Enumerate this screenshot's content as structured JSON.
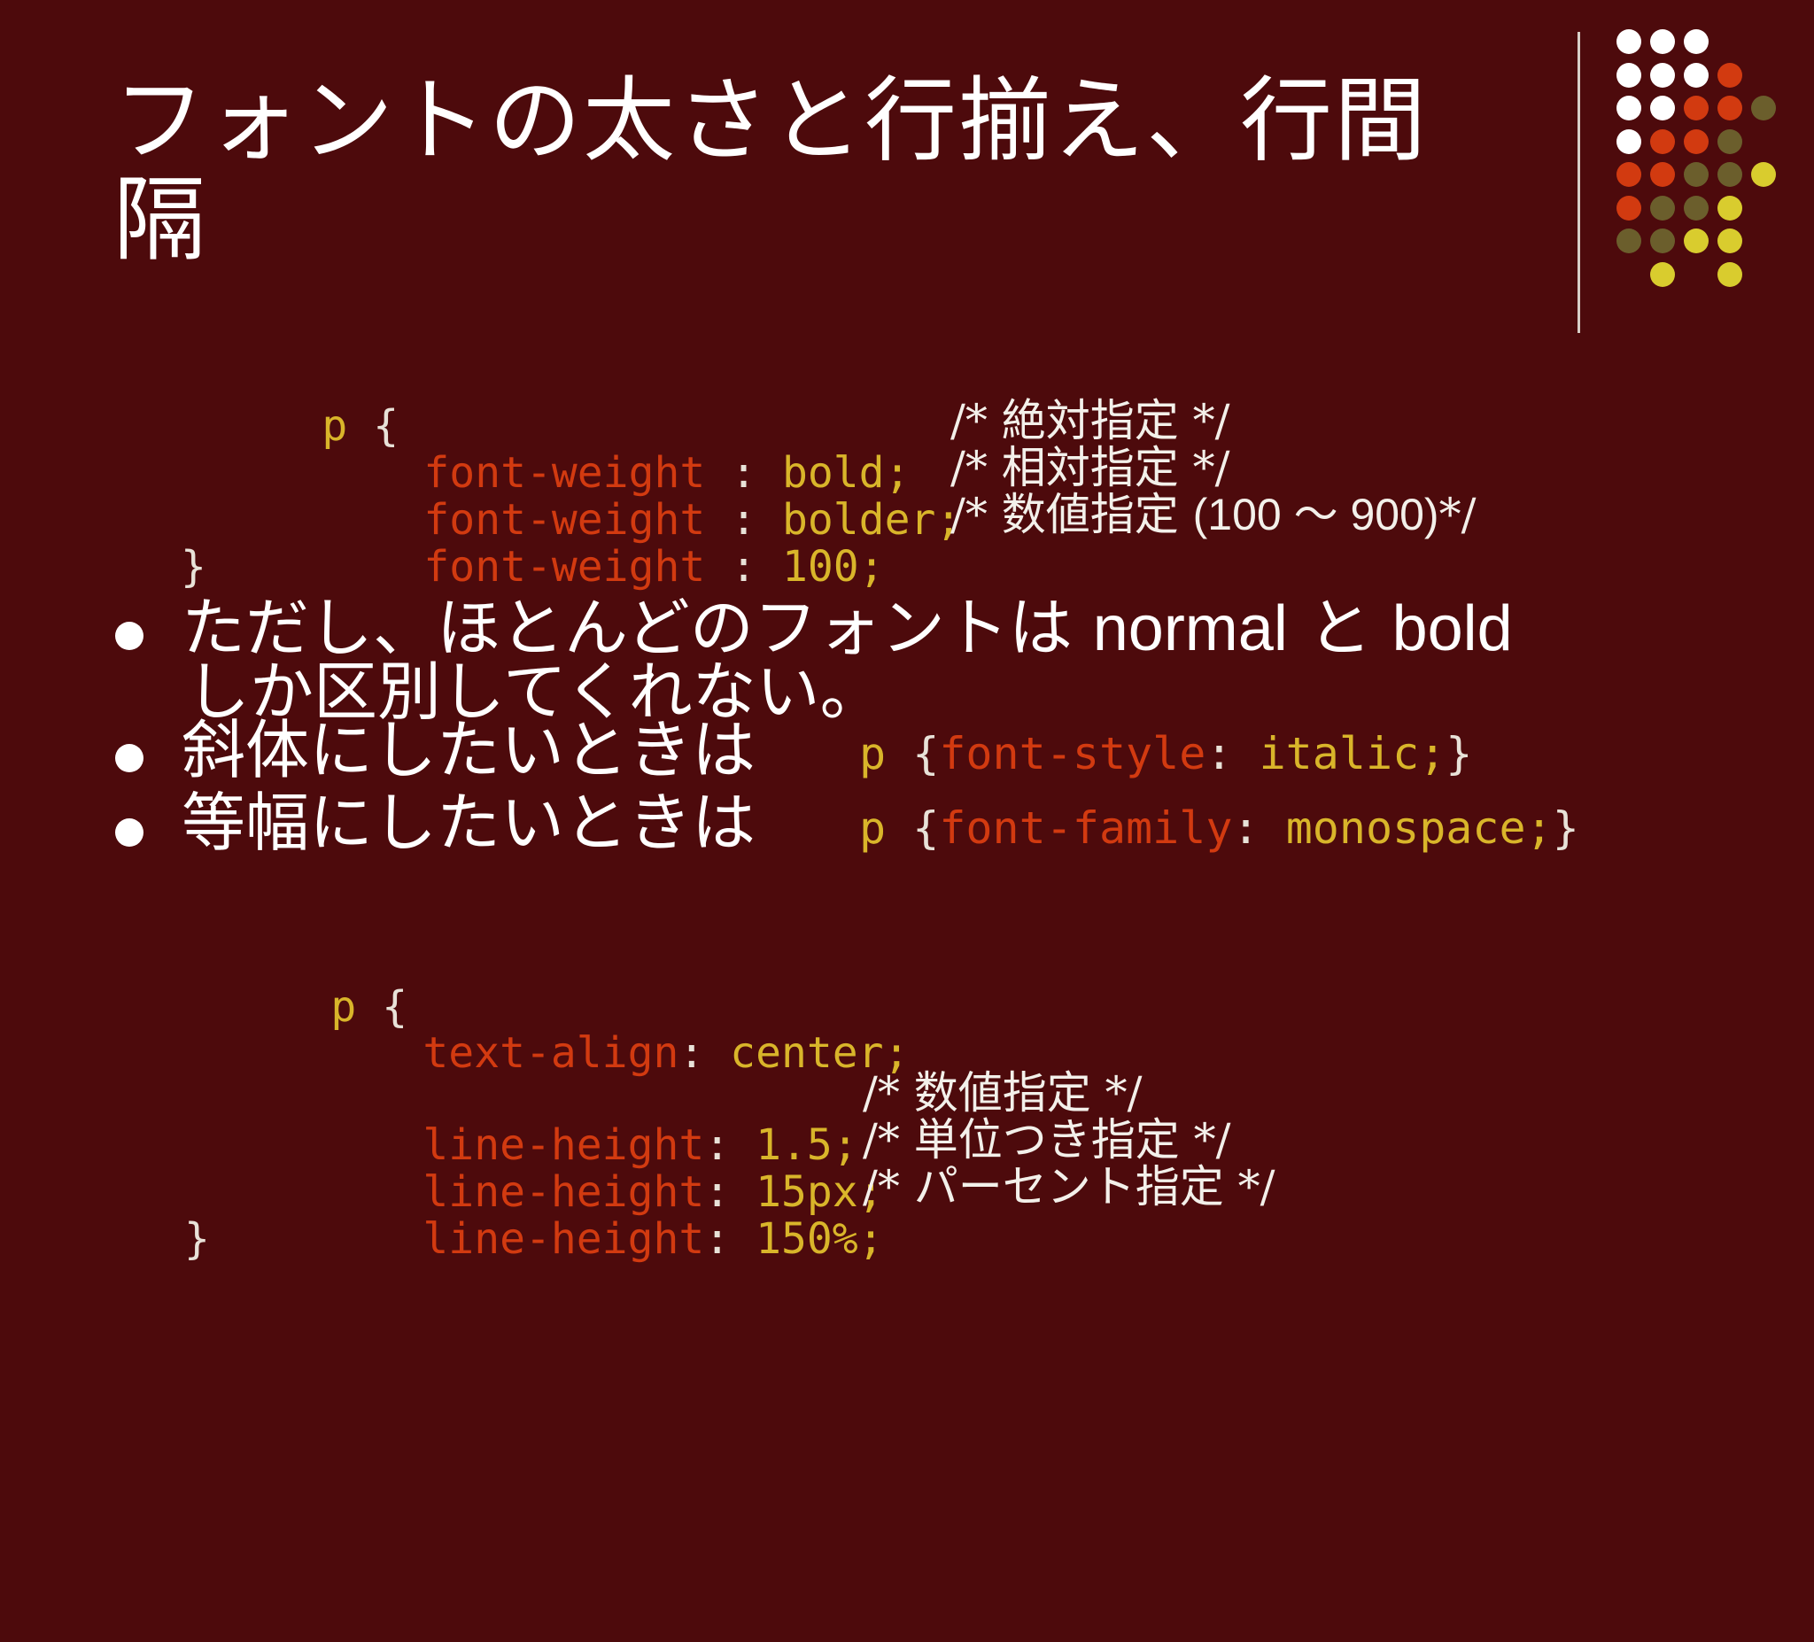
{
  "slide": {
    "title_line1": "フォントの太さと行揃え、行間",
    "title_line2": "隔",
    "colors": {
      "background": "#4d0a0c",
      "property": "#d23a10",
      "value": "#d9b52a",
      "text": "#ffffff",
      "dot_white": "#ffffff",
      "dot_orange": "#d23a10",
      "dot_olive": "#6b5e2c",
      "dot_yellow": "#d9cc2e"
    }
  },
  "code1": {
    "selector": "p",
    "open": "{",
    "close": "}",
    "rows": [
      {
        "prop": "font-weight",
        "sep": " : ",
        "value": "bold;",
        "comment": "/* 絶対指定 */"
      },
      {
        "prop": "font-weight",
        "sep": " : ",
        "value": "bolder;",
        "comment": "/* 相対指定 */"
      },
      {
        "prop": "font-weight",
        "sep": " : ",
        "value": "100;",
        "comment_pre": "/* 数値指定 ",
        "comment_num": "(100 ～ 900)",
        "comment_post": "*/"
      }
    ]
  },
  "bullets": [
    {
      "text_a": "ただし、ほとんどのフォントは ",
      "latin1": "normal",
      "text_b": " と ",
      "latin2": "bold",
      "text_c": "しか区別してくれない。"
    },
    {
      "text": "斜体にしたいときは",
      "code_sel": "p",
      "code_open": "{",
      "code_prop": "font-style",
      "code_colon": ": ",
      "code_value": "italic;",
      "code_close": "}"
    },
    {
      "text": "等幅にしたいときは",
      "code_sel": "p",
      "code_open": "{",
      "code_prop": "font-family",
      "code_colon": ": ",
      "code_value": "monospace;",
      "code_close": "}"
    }
  ],
  "code2": {
    "selector": "p",
    "open": "{",
    "close": "}",
    "align_prop": "text-align",
    "align_colon": ": ",
    "align_value": "center;",
    "rows": [
      {
        "prop": "line-height",
        "colon": ": ",
        "value": "1.5;",
        "comment": "/* 数値指定 */"
      },
      {
        "prop": "line-height",
        "colon": ": ",
        "value": "15px;",
        "comment": "/* 単位つき指定 */"
      },
      {
        "prop": "line-height",
        "colon": ": ",
        "value": "150%;",
        "comment": "/* パーセント指定 */"
      }
    ]
  }
}
